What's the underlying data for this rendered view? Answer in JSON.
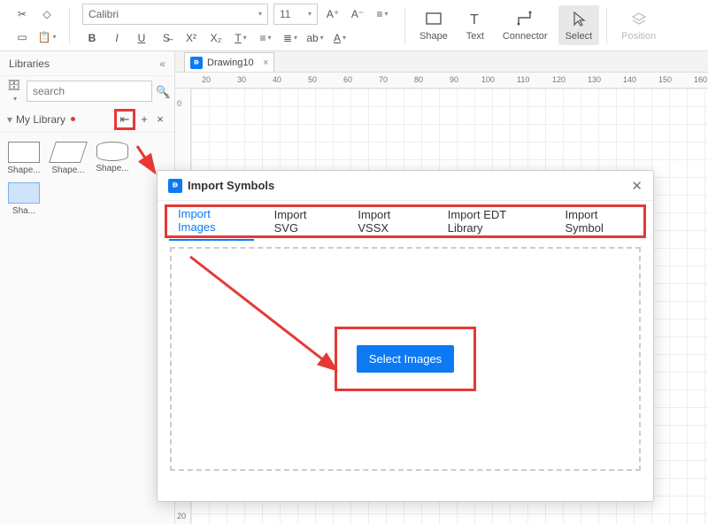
{
  "toolbar": {
    "font": "Calibri",
    "size": "11",
    "shape": "Shape",
    "text": "Text",
    "connector": "Connector",
    "select": "Select",
    "position": "Position"
  },
  "left": {
    "libraries": "Libraries",
    "search_ph": "search",
    "mylib": "My Library",
    "shapes": [
      "Shape...",
      "Shape...",
      "Shape...",
      "Sha..."
    ]
  },
  "tab": {
    "name": "Drawing10"
  },
  "ruler_h": [
    20,
    30,
    40,
    50,
    60,
    70,
    80,
    90,
    100,
    110,
    120,
    130,
    140,
    150,
    160
  ],
  "ruler_v": [
    0,
    20
  ],
  "dialog": {
    "title": "Import Symbols",
    "tabs": [
      "Import Images",
      "Import SVG",
      "Import VSSX",
      "Import EDT Library",
      "Import Symbol"
    ],
    "button": "Select Images"
  }
}
